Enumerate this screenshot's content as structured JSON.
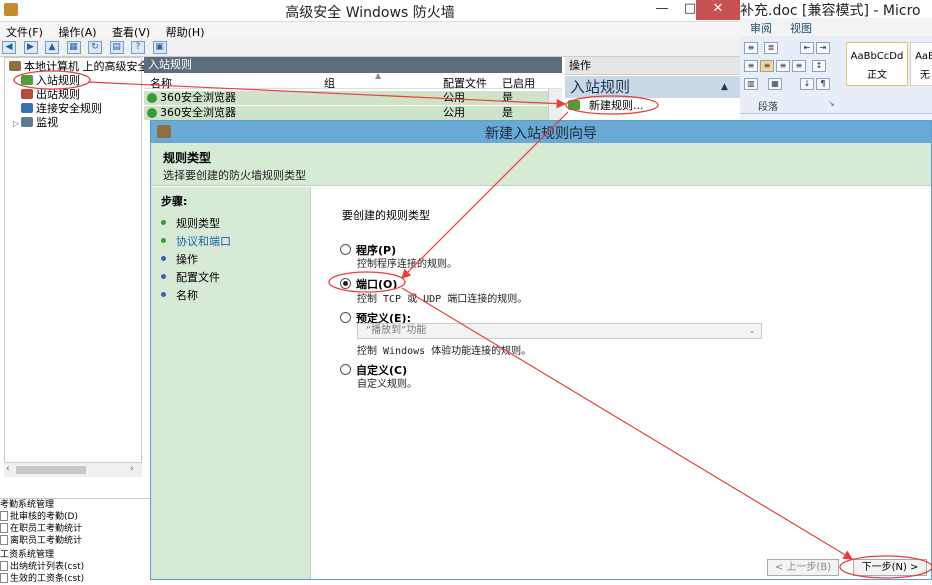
{
  "firewall": {
    "title": "高级安全 Windows 防火墙",
    "menu": [
      "文件(F)",
      "操作(A)",
      "查看(V)",
      "帮助(H)"
    ],
    "tree": {
      "root": "本地计算机 上的高级安全",
      "items": [
        "入站规则",
        "出站规则",
        "连接安全规则",
        "监视"
      ]
    },
    "list": {
      "header": "入站规则",
      "columns": [
        "名称",
        "组",
        "配置文件",
        "已启用"
      ],
      "rows": [
        {
          "name": "360安全浏览器",
          "profile": "公用",
          "enabled": "是"
        },
        {
          "name": "360安全浏览器",
          "profile": "公用",
          "enabled": "是"
        }
      ]
    },
    "actions": {
      "header": "操作",
      "sub": "入站规则",
      "new_rule": "新建规则..."
    }
  },
  "bottom_list": {
    "items": [
      "考勤系统管理",
      "批审核的考勤(D)",
      "在职员工考勤统计",
      "离职员工考勤统计",
      "工资系统管理",
      "出纳统计列表(cst)",
      "生效的工资条(cst)"
    ]
  },
  "word": {
    "title": "补充.doc [兼容模式] - Micro",
    "tabs": [
      "审阅",
      "视图"
    ],
    "style1_sample": "AaBbCcDd",
    "style1_name": "正文",
    "style2_sample": "AaB",
    "style2_name": "无",
    "group_label": "段落"
  },
  "wizard": {
    "title": "新建入站规则向导",
    "header_title": "规则类型",
    "header_desc": "选择要创建的防火墙规则类型",
    "steps_title": "步骤:",
    "steps": [
      "规则类型",
      "协议和端口",
      "操作",
      "配置文件",
      "名称"
    ],
    "prompt": "要创建的规则类型",
    "options": [
      {
        "label": "程序(P)",
        "desc": "控制程序连接的规则。"
      },
      {
        "label": "端口(O)",
        "desc": "控制 TCP 或 UDP 端口连接的规则。"
      },
      {
        "label": "预定义(E):",
        "desc": "控制 Windows 体验功能连接的规则。"
      },
      {
        "label": "自定义(C)",
        "desc": "自定义规则。"
      }
    ],
    "predef_value": "“播放到”功能",
    "back_button": "< 上一步(B)",
    "next_button": "下一步(N) >"
  },
  "colors": {
    "highlight_green": "#cfe3c8",
    "wizard_titlebar": "#6aa9d6",
    "annotation_red": "#e8413b"
  }
}
